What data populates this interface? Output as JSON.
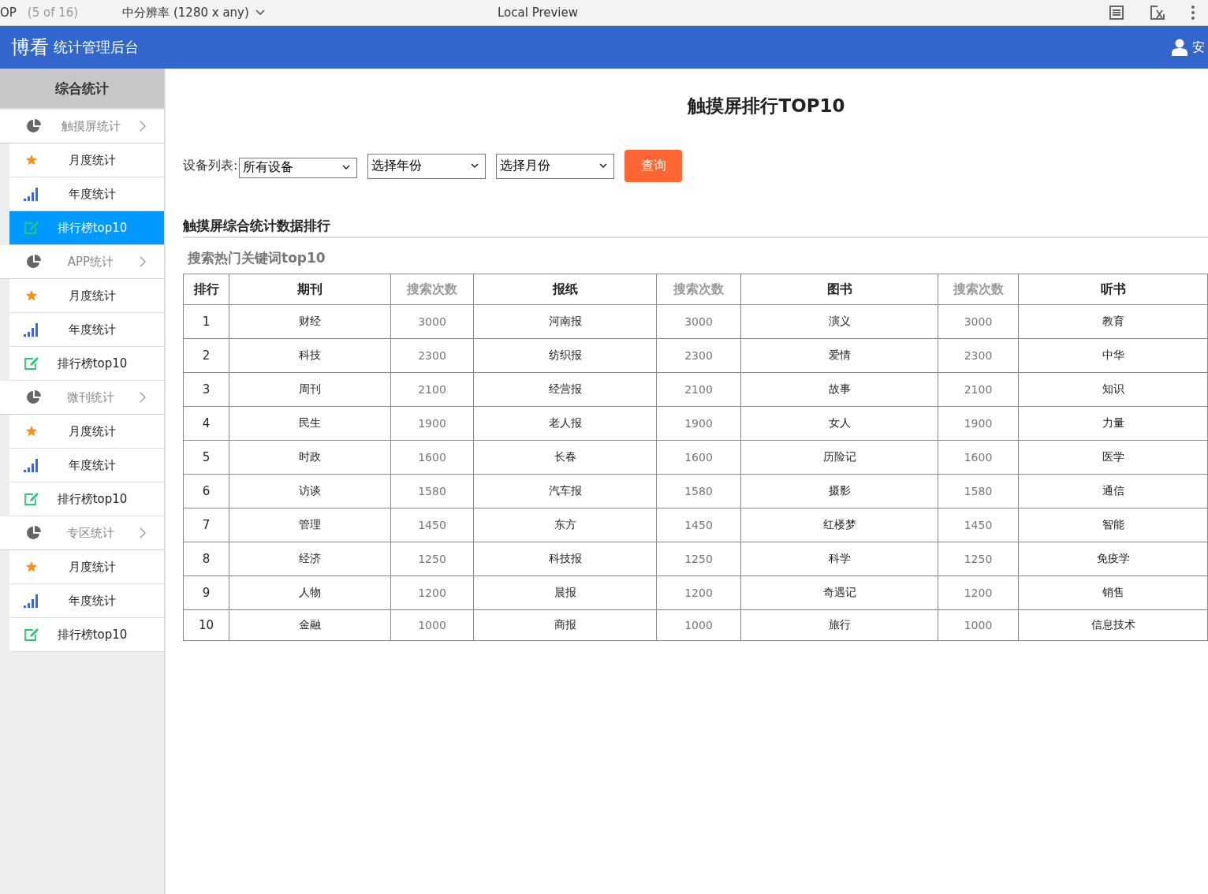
{
  "preview_bar": {
    "project": "OP",
    "page_count": "(5 of 16)",
    "resolution": "中分辨率 (1280 x any)",
    "title": "Local Preview"
  },
  "header": {
    "logo": "博看",
    "subtitle": "统计管理后台",
    "user": "安"
  },
  "sidebar": {
    "title": "综合统计",
    "groups": [
      {
        "label": "触摸屏统计",
        "items": [
          {
            "kind": "star",
            "label": "月度统计",
            "selected": false
          },
          {
            "kind": "bars",
            "label": "年度统计",
            "selected": false
          },
          {
            "kind": "edit",
            "label": "排行榜top10",
            "selected": true
          }
        ]
      },
      {
        "label": "APP统计",
        "items": [
          {
            "kind": "star",
            "label": "月度统计",
            "selected": false
          },
          {
            "kind": "bars",
            "label": "年度统计",
            "selected": false
          },
          {
            "kind": "edit",
            "label": "排行榜top10",
            "selected": false
          }
        ]
      },
      {
        "label": "微刊统计",
        "items": [
          {
            "kind": "star",
            "label": "月度统计",
            "selected": false
          },
          {
            "kind": "bars",
            "label": "年度统计",
            "selected": false
          },
          {
            "kind": "edit",
            "label": "排行榜top10",
            "selected": false
          }
        ]
      },
      {
        "label": "专区统计",
        "items": [
          {
            "kind": "star",
            "label": "月度统计",
            "selected": false
          },
          {
            "kind": "bars",
            "label": "年度统计",
            "selected": false
          },
          {
            "kind": "edit",
            "label": "排行榜top10",
            "selected": false
          }
        ]
      }
    ]
  },
  "main": {
    "title": "触摸屏排行TOP10",
    "filter_label": "设备列表:",
    "selects": [
      "所有设备",
      "选择年份",
      "选择月份"
    ],
    "query_button": "查询",
    "section_title": "触摸屏综合统计数据排行",
    "subsection_title": "搜索热门关键词top10",
    "table": {
      "columns": [
        {
          "kind": "rank",
          "label": "排行"
        },
        {
          "kind": "name",
          "label": "期刊"
        },
        {
          "kind": "count",
          "label": "搜索次数"
        },
        {
          "kind": "name",
          "label": "报纸"
        },
        {
          "kind": "count",
          "label": "搜索次数"
        },
        {
          "kind": "name",
          "label": "图书"
        },
        {
          "kind": "count",
          "label": "搜索次数"
        },
        {
          "kind": "name",
          "label": "听书"
        }
      ],
      "rows": [
        [
          "1",
          "财经",
          "3000",
          "河南报",
          "3000",
          "演义",
          "3000",
          "教育"
        ],
        [
          "2",
          "科技",
          "2300",
          "纺织报",
          "2300",
          "爱情",
          "2300",
          "中华"
        ],
        [
          "3",
          "周刊",
          "2100",
          "经营报",
          "2100",
          "故事",
          "2100",
          "知识"
        ],
        [
          "4",
          "民生",
          "1900",
          "老人报",
          "1900",
          "女人",
          "1900",
          "力量"
        ],
        [
          "5",
          "时政",
          "1600",
          "长春",
          "1600",
          "历险记",
          "1600",
          "医学"
        ],
        [
          "6",
          "访谈",
          "1580",
          "汽车报",
          "1580",
          "摄影",
          "1580",
          "通信"
        ],
        [
          "7",
          "管理",
          "1450",
          "东方",
          "1450",
          "红楼梦",
          "1450",
          "智能"
        ],
        [
          "8",
          "经济",
          "1250",
          "科技报",
          "1250",
          "科学",
          "1250",
          "免疫学"
        ],
        [
          "9",
          "人物",
          "1200",
          "晨报",
          "1200",
          "奇遇记",
          "1200",
          "销售"
        ],
        [
          "10",
          "金融",
          "1000",
          "商报",
          "1000",
          "旅行",
          "1000",
          "信息技术"
        ]
      ]
    }
  }
}
